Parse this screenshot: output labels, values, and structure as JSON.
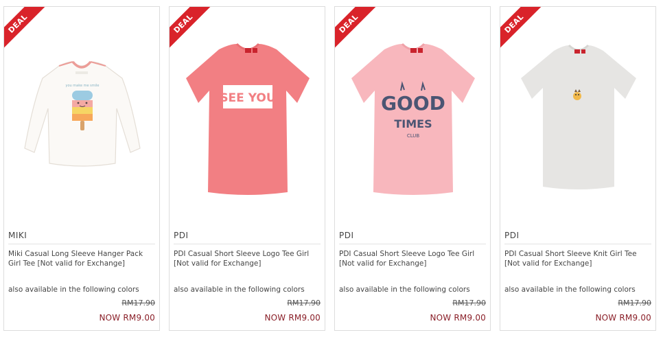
{
  "products": [
    {
      "deal_label": "DEAL",
      "brand": "MIKI",
      "title": "Miki Casual Long Sleeve Hanger Pack Girl Tee [Not valid for Exchange]",
      "colors_note": "also available in the following colors",
      "old_price": "RM17.90",
      "now_price": "NOW RM9.00",
      "image_icon": "long-sleeve-tee-popsicle"
    },
    {
      "deal_label": "DEAL",
      "brand": "PDI",
      "title": "PDI Casual Short Sleeve Logo Tee Girl [Not valid for Exchange]",
      "colors_note": "also available in the following colors",
      "old_price": "RM17.90",
      "now_price": "NOW RM9.00",
      "image_icon": "coral-tee-see-you",
      "print_text": "SEE YOU"
    },
    {
      "deal_label": "DEAL",
      "brand": "PDI",
      "title": "PDI Casual Short Sleeve Logo Tee Girl [Not valid for Exchange]",
      "colors_note": "also available in the following colors",
      "old_price": "RM17.90",
      "now_price": "NOW RM9.00",
      "image_icon": "pink-tee-good-times",
      "print_line1": "GOOD",
      "print_line2": "TIMES",
      "print_line3": "CLUB"
    },
    {
      "deal_label": "DEAL",
      "brand": "PDI",
      "title": "PDI Casual Short Sleeve Knit Girl Tee [Not valid for Exchange]",
      "colors_note": "also available in the following colors",
      "old_price": "RM17.90",
      "now_price": "NOW RM9.00",
      "image_icon": "grey-knit-tee"
    }
  ],
  "colors": {
    "deal_red": "#d9232a",
    "now_price": "#8a1f28",
    "border": "#dcdcdc"
  }
}
